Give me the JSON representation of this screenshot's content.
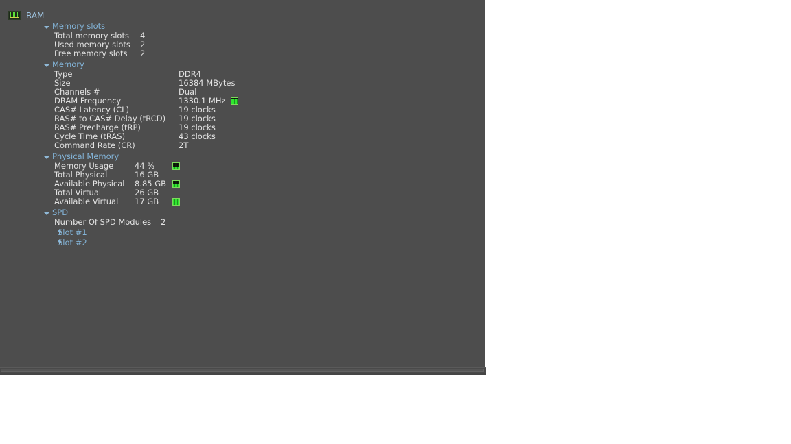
{
  "window": {
    "title": "RAM",
    "root_icon": "ram-stick-icon"
  },
  "colors": {
    "panel_bg": "#4d4d4d",
    "group_header": "#83b4d8",
    "body_text": "#e2e2e2",
    "accent_green": "#2fe82f"
  },
  "groups": [
    {
      "name": "memory-slots",
      "label": "Memory slots",
      "expanded": true,
      "items": [
        {
          "label": "Total memory slots",
          "value": "4",
          "graph": false
        },
        {
          "label": "Used memory slots",
          "value": "2",
          "graph": false
        },
        {
          "label": "Free memory slots",
          "value": "2",
          "graph": false
        }
      ]
    },
    {
      "name": "memory",
      "label": "Memory",
      "expanded": true,
      "items": [
        {
          "label": "Type",
          "value": "DDR4",
          "graph": false
        },
        {
          "label": "Size",
          "value": "16384 MBytes",
          "graph": false
        },
        {
          "label": "Channels #",
          "value": "Dual",
          "graph": false
        },
        {
          "label": "DRAM Frequency",
          "value": "1330.1 MHz",
          "graph": true,
          "graph_fill": 80
        },
        {
          "label": "CAS# Latency (CL)",
          "value": "19 clocks",
          "graph": false
        },
        {
          "label": "RAS# to CAS# Delay (tRCD)",
          "value": "19 clocks",
          "graph": false
        },
        {
          "label": "RAS# Precharge (tRP)",
          "value": "19 clocks",
          "graph": false
        },
        {
          "label": "Cycle Time (tRAS)",
          "value": "43 clocks",
          "graph": false
        },
        {
          "label": "Command Rate (CR)",
          "value": "2T",
          "graph": false
        }
      ]
    },
    {
      "name": "physical-memory",
      "label": "Physical Memory",
      "expanded": true,
      "items": [
        {
          "label": "Memory Usage",
          "value": "44 %",
          "graph": true,
          "graph_fill": 44
        },
        {
          "label": "Total Physical",
          "value": "16 GB",
          "graph": false
        },
        {
          "label": "Available Physical",
          "value": "8.85 GB",
          "graph": true,
          "graph_fill": 55
        },
        {
          "label": "Total Virtual",
          "value": "26 GB",
          "graph": false
        },
        {
          "label": "Available Virtual",
          "value": "17 GB",
          "graph": true,
          "graph_fill": 90
        }
      ]
    },
    {
      "name": "spd",
      "label": "SPD",
      "expanded": true,
      "items": [
        {
          "label": "Number Of SPD Modules",
          "value": "2",
          "graph": false
        }
      ],
      "slots": [
        {
          "label": "Slot #1",
          "expanded": false
        },
        {
          "label": "Slot #2",
          "expanded": false
        }
      ]
    }
  ]
}
